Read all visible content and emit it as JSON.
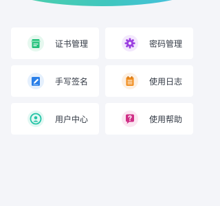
{
  "menu": {
    "items": [
      {
        "label": "证书管理",
        "icon": "certificate-icon",
        "color": "#22c07a"
      },
      {
        "label": "密码管理",
        "icon": "gear-icon",
        "color": "#9b3fe0"
      },
      {
        "label": "手写签名",
        "icon": "pen-note-icon",
        "color": "#2a7fe8"
      },
      {
        "label": "使用日志",
        "icon": "log-list-icon",
        "color": "#f08c1c"
      },
      {
        "label": "用户中心",
        "icon": "user-icon",
        "color": "#22c3a5"
      },
      {
        "label": "使用帮助",
        "icon": "help-icon",
        "color": "#cf2f86"
      }
    ]
  }
}
